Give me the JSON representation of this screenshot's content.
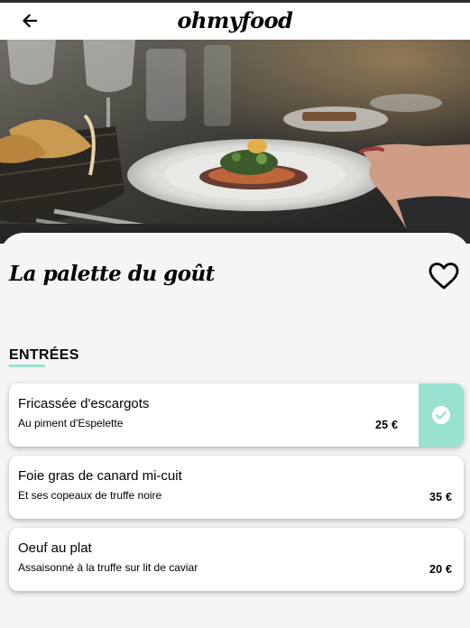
{
  "header": {
    "logo": "ohmyfood",
    "back_icon": "arrow-left-icon"
  },
  "restaurant": {
    "name": "La palette du goût",
    "favorite_icon": "heart-outline-icon"
  },
  "menu": {
    "section_title": "ENTRÉES",
    "items": [
      {
        "name": "Fricassée d'escargots",
        "description": "Au piment d'Espelette",
        "price": "25 €",
        "selected": true
      },
      {
        "name": "Foie gras de canard mi-cuit",
        "description": "Et ses copeaux de truffe noire",
        "price": "35 €",
        "selected": false
      },
      {
        "name": "Oeuf au plat",
        "description": "Assaisonné à la truffe sur lit de caviar",
        "price": "20 €",
        "selected": false
      }
    ]
  },
  "colors": {
    "accent": "#99e2d0",
    "background": "#f5f5f5",
    "card": "#ffffff"
  }
}
